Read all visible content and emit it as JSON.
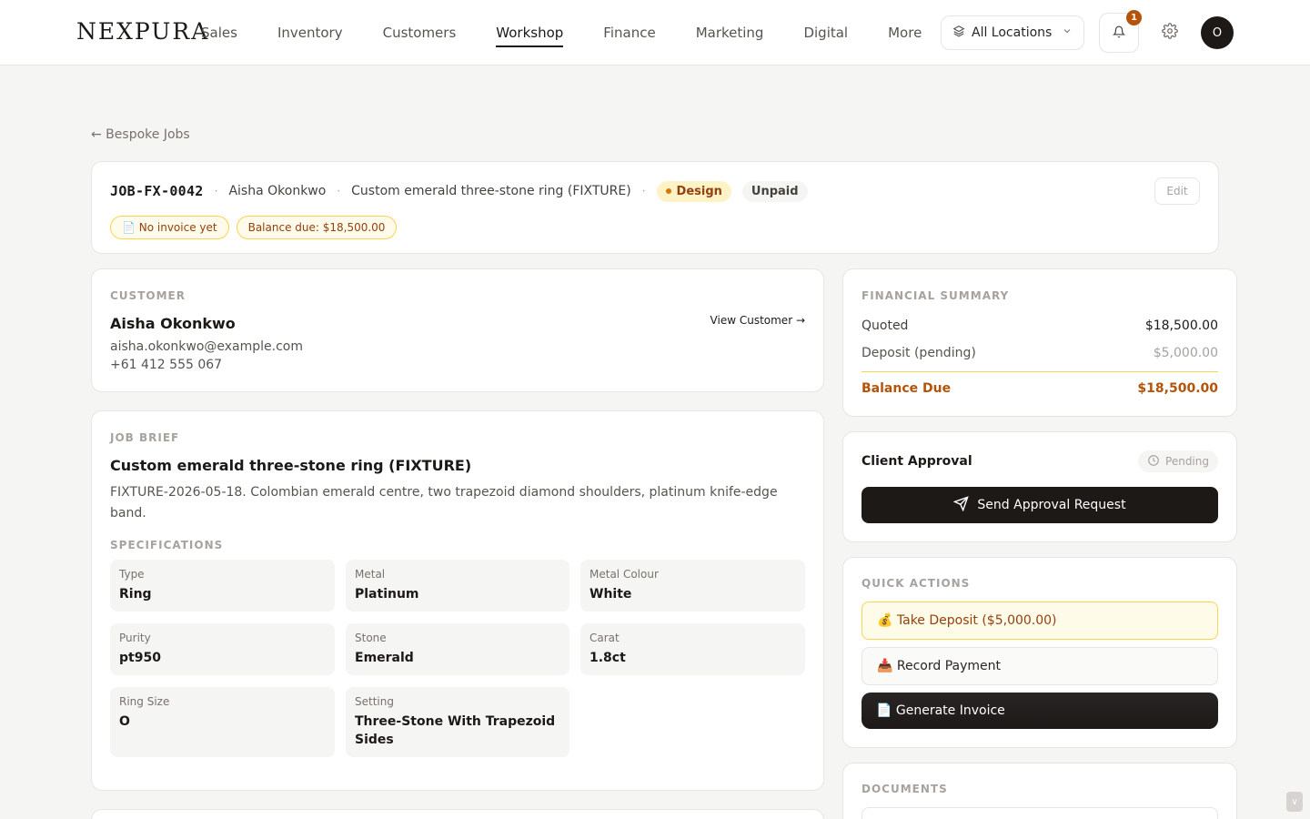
{
  "brand": {
    "logo": "NEXPURA"
  },
  "nav": {
    "items": [
      {
        "label": "Sales"
      },
      {
        "label": "Inventory"
      },
      {
        "label": "Customers"
      },
      {
        "label": "Workshop",
        "active": true
      },
      {
        "label": "Finance"
      },
      {
        "label": "Marketing"
      },
      {
        "label": "Digital"
      },
      {
        "label": "More"
      }
    ],
    "location_label": "All Locations",
    "notification_count": "1",
    "avatar_initial": "O"
  },
  "breadcrumb": {
    "back_label": "← Bespoke Jobs"
  },
  "job": {
    "id": "JOB-FX-0042",
    "customer": "Aisha Okonkwo",
    "title": "Custom emerald three-stone ring (FIXTURE)",
    "stage": "Design",
    "payment_status": "Unpaid",
    "edit_label": "Edit",
    "invoice_tag": "📄 No invoice yet",
    "balance_tag": "Balance due: $18,500.00"
  },
  "customer": {
    "section_label": "CUSTOMER",
    "name": "Aisha Okonkwo",
    "email": "aisha.okonkwo@example.com",
    "phone": "+61 412 555 067",
    "view_label": "View Customer →"
  },
  "brief": {
    "section_label": "JOB BRIEF",
    "title": "Custom emerald three-stone ring (FIXTURE)",
    "description": "FIXTURE-2026-05-18. Colombian emerald centre, two trapezoid diamond shoulders, platinum knife-edge band.",
    "specs_label": "SPECIFICATIONS",
    "specs": [
      {
        "label": "Type",
        "value": "Ring"
      },
      {
        "label": "Metal",
        "value": "Platinum"
      },
      {
        "label": "Metal Colour",
        "value": "White"
      },
      {
        "label": "Purity",
        "value": "pt950"
      },
      {
        "label": "Stone",
        "value": "Emerald"
      },
      {
        "label": "Carat",
        "value": "1.8ct"
      },
      {
        "label": "Ring Size",
        "value": "O"
      },
      {
        "label": "Setting",
        "value": "Three-Stone With Trapezoid Sides"
      }
    ]
  },
  "financial": {
    "section_label": "FINANCIAL SUMMARY",
    "quoted_label": "Quoted",
    "quoted_value": "$18,500.00",
    "deposit_label": "Deposit (pending)",
    "deposit_value": "$5,000.00",
    "balance_label": "Balance Due",
    "balance_value": "$18,500.00"
  },
  "approval": {
    "title": "Client Approval",
    "status": "Pending",
    "send_label": "Send Approval Request"
  },
  "quick_actions": {
    "section_label": "QUICK ACTIONS",
    "deposit_label": "💰 Take Deposit ($5,000.00)",
    "record_label": "📥 Record Payment",
    "invoice_label": "📄 Generate Invoice"
  },
  "documents": {
    "section_label": "DOCUMENTS"
  },
  "colors": {
    "accent": "#b45309",
    "design_pill": "#fef3c7",
    "dark": "#1c1917"
  }
}
